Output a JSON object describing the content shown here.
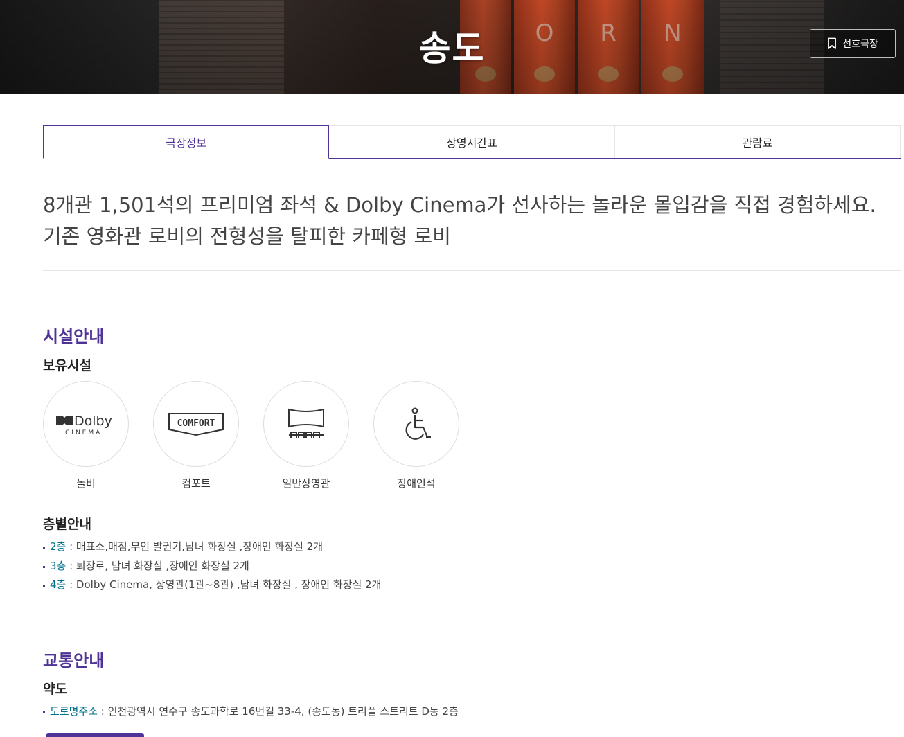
{
  "header": {
    "title": "송도",
    "favorite_label": "선호극장",
    "pillar_letters": [
      "O",
      "R",
      "N"
    ]
  },
  "tabs": [
    {
      "label": "극장정보",
      "active": true
    },
    {
      "label": "상영시간표",
      "active": false
    },
    {
      "label": "관람료",
      "active": false
    }
  ],
  "intro": {
    "line1": "8개관 1,501석의 프리미엄 좌석 & Dolby Cinema가 선사하는 놀라운 몰입감을 직접 경험하세요.",
    "line2": "기존 영화관 로비의 전형성을 탈피한 카페형 로비"
  },
  "facility_section": {
    "title": "시설안내",
    "owned_title": "보유시설",
    "items": [
      {
        "label": "돌비",
        "icon": "dolby-cinema-icon",
        "logo_main": "Dolby",
        "logo_sub": "CINEMA"
      },
      {
        "label": "컴포트",
        "icon": "comfort-icon",
        "logo_main": "COMFORT"
      },
      {
        "label": "일반상영관",
        "icon": "theater-screen-icon"
      },
      {
        "label": "장애인석",
        "icon": "wheelchair-icon"
      }
    ],
    "floor_title": "층별안내",
    "floors": [
      {
        "floor": "2층",
        "desc": " : 매표소,매점,무인 발권기,남녀 화장실 ,장애인 화장실 2개"
      },
      {
        "floor": "3층",
        "desc": " : 퇴장로, 남녀 화장실 ,장애인 화장실 2개"
      },
      {
        "floor": "4층",
        "desc": " : Dolby Cinema, 상영관(1관~8관) ,남녀 화장실 , 장애인 화장실 2개"
      }
    ]
  },
  "traffic_section": {
    "title": "교통안내",
    "sub_title": "약도",
    "address_key": "도로명주소",
    "address_value": " : 인천광역시 연수구 송도과학로 16번길 33-4, (송도동) 트리플 스트리트 D동 2층"
  },
  "colors": {
    "accent": "#503396",
    "link": "#01738b"
  }
}
